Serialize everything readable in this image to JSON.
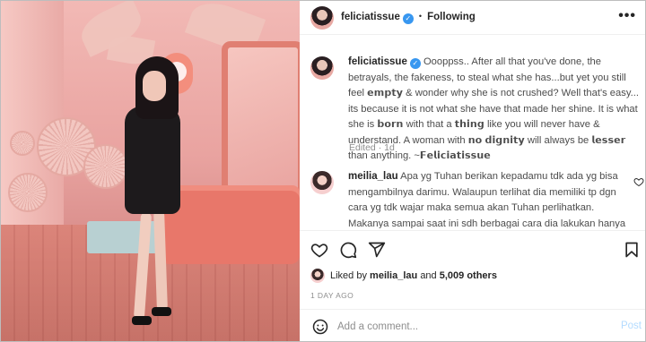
{
  "post": {
    "username": "feliciatissue",
    "verified_mark": "✓",
    "separator": "•",
    "follow_status": "Following",
    "more_options": "•••"
  },
  "caption": {
    "username": "feliciatissue",
    "text": "Oooppss.. After all that you've done, the betrayals, the fakeness, to steal what she has...but yet you still feel 𝗲𝗺𝗽𝘁𝘆 & wonder why she is not crushed? Well that's easy... its because it is not what she have that made her shine. It is what she is 𝗯𝗼𝗿𝗻 with that a 𝘁𝗵𝗶𝗻𝗴 like you will never have & understand. A woman with 𝗻𝗼 𝗱𝗶𝗴𝗻𝗶𝘁𝘆 will always be 𝗹𝗲𝘀𝘀𝗲𝗿 than anything. ~𝗙𝗲𝗹𝗶𝗰𝗶𝗮𝘁𝗶𝘀𝘀𝘂𝗲",
    "edited": "Edited",
    "dot": "·",
    "age": "1d"
  },
  "comment": {
    "username": "meilia_lau",
    "text": "Apa yg Tuhan berikan kepadamu tdk ada yg bisa mengambilnya darimu. Walaupun terlihat dia memiliki tp dgn cara yg tdk wajar maka semua akan Tuhan perlihatkan. Makanya sampai saat ini sdh berbagai cara dia lakukan hanya ingin menjadi dirimu. Krn dia tdk akan bisa menjadi dirinya sendiri"
  },
  "actions": {
    "like_icon": "heart-icon",
    "comment_icon": "comment-icon",
    "share_icon": "share-icon",
    "save_icon": "bookmark-icon"
  },
  "likes": {
    "prefix": "Liked by",
    "user": "meilia_lau",
    "conjunction": "and",
    "count": "5,009 others"
  },
  "timestamp": "1 DAY AGO",
  "add_comment": {
    "placeholder": "Add a comment...",
    "post_label": "Post"
  },
  "colors": {
    "verified": "#3897f0",
    "post_button_disabled": "#b3dbff",
    "secondary_text": "#8e8e8e"
  }
}
